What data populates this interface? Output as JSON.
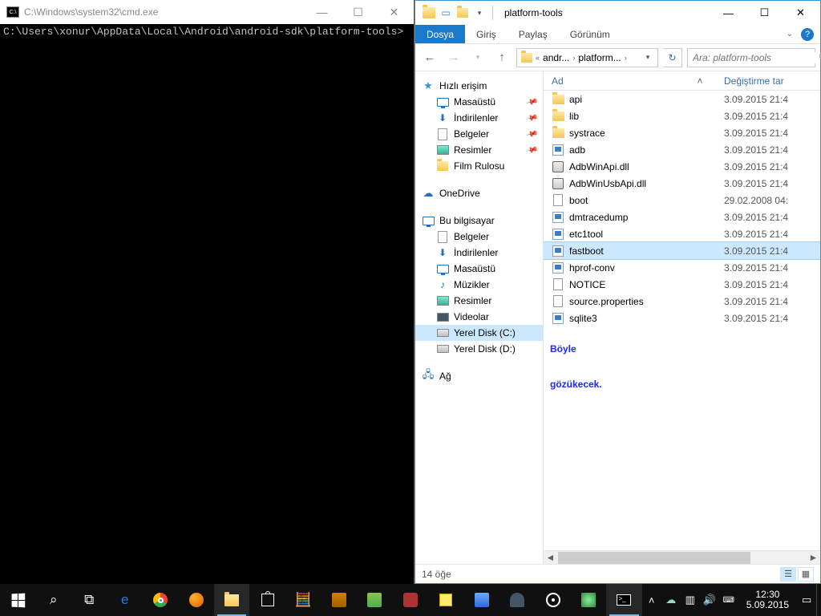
{
  "cmd": {
    "title": "C:\\Windows\\system32\\cmd.exe",
    "body": "C:\\Users\\xonur\\AppData\\Local\\Android\\android-sdk\\platform-tools>"
  },
  "explorer": {
    "title": "platform-tools",
    "tabs": {
      "file": "Dosya",
      "home": "Giriş",
      "share": "Paylaş",
      "view": "Görünüm"
    },
    "address": {
      "seg1": "andr...",
      "seg2": "platform..."
    },
    "search_placeholder": "Ara: platform-tools",
    "columns": {
      "name": "Ad",
      "date": "Değiştirme tar"
    },
    "nav": {
      "quick": "Hızlı erişim",
      "quick_items": [
        {
          "label": "Masaüstü",
          "pin": true,
          "icon": "desktop"
        },
        {
          "label": "İndirilenler",
          "pin": true,
          "icon": "download"
        },
        {
          "label": "Belgeler",
          "pin": true,
          "icon": "doc"
        },
        {
          "label": "Resimler",
          "pin": true,
          "icon": "pic"
        },
        {
          "label": "Film Rulosu",
          "pin": false,
          "icon": "folder"
        }
      ],
      "onedrive": "OneDrive",
      "thispc": "Bu bilgisayar",
      "pc_items": [
        {
          "label": "Belgeler",
          "icon": "doc"
        },
        {
          "label": "İndirilenler",
          "icon": "download"
        },
        {
          "label": "Masaüstü",
          "icon": "desktop"
        },
        {
          "label": "Müzikler",
          "icon": "music"
        },
        {
          "label": "Resimler",
          "icon": "pic"
        },
        {
          "label": "Videolar",
          "icon": "video"
        },
        {
          "label": "Yerel Disk (C:)",
          "icon": "disk",
          "sel": true
        },
        {
          "label": "Yerel Disk (D:)",
          "icon": "disk"
        }
      ],
      "network": "Ağ"
    },
    "files": [
      {
        "name": "api",
        "date": "3.09.2015 21:4",
        "type": "folder"
      },
      {
        "name": "lib",
        "date": "3.09.2015 21:4",
        "type": "folder"
      },
      {
        "name": "systrace",
        "date": "3.09.2015 21:4",
        "type": "folder"
      },
      {
        "name": "adb",
        "date": "3.09.2015 21:4",
        "type": "exe"
      },
      {
        "name": "AdbWinApi.dll",
        "date": "3.09.2015 21:4",
        "type": "gear"
      },
      {
        "name": "AdbWinUsbApi.dll",
        "date": "3.09.2015 21:4",
        "type": "gear"
      },
      {
        "name": "boot",
        "date": "29.02.2008 04:",
        "type": "doc"
      },
      {
        "name": "dmtracedump",
        "date": "3.09.2015 21:4",
        "type": "exe"
      },
      {
        "name": "etc1tool",
        "date": "3.09.2015 21:4",
        "type": "exe"
      },
      {
        "name": "fastboot",
        "date": "3.09.2015 21:4",
        "type": "exe",
        "sel": true
      },
      {
        "name": "hprof-conv",
        "date": "3.09.2015 21:4",
        "type": "exe"
      },
      {
        "name": "NOTICE",
        "date": "3.09.2015 21:4",
        "type": "doc"
      },
      {
        "name": "source.properties",
        "date": "3.09.2015 21:4",
        "type": "doc"
      },
      {
        "name": "sqlite3",
        "date": "3.09.2015 21:4",
        "type": "exe"
      }
    ],
    "annotation_l1": "Böyle",
    "annotation_l2": "gözükecek.",
    "status": "14 öğe"
  },
  "taskbar": {
    "clock_time": "12:30",
    "clock_date": "5.09.2015"
  }
}
